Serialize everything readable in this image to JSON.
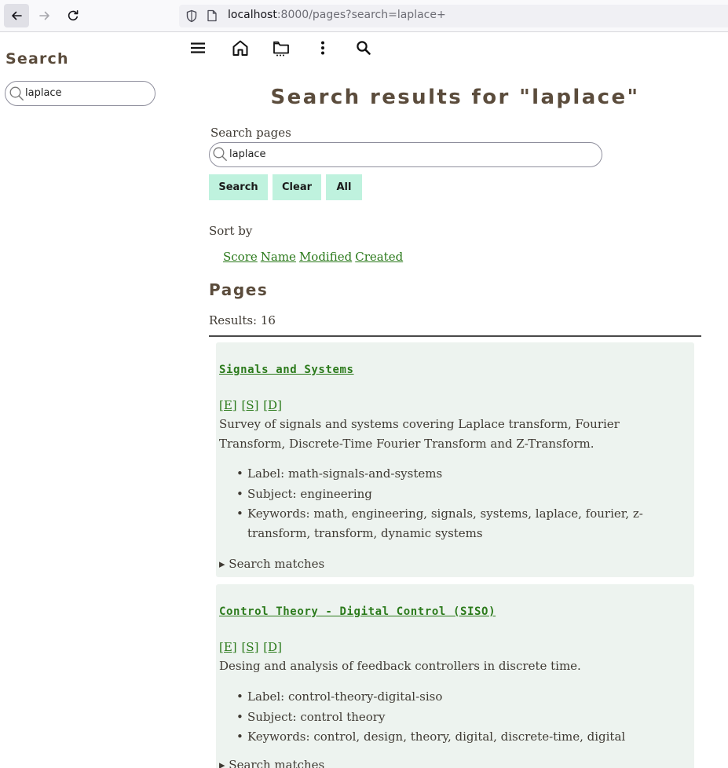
{
  "browser": {
    "url_host": "localhost",
    "url_rest": ":8000/pages?search=laplace+"
  },
  "sidebar": {
    "title": "Search",
    "search_value": "laplace"
  },
  "main": {
    "title": "Search results for \"laplace\"",
    "search_label": "Search pages",
    "search_value": "laplace",
    "buttons": {
      "search": "Search",
      "clear": "Clear",
      "all": "All"
    },
    "sort_label": "Sort by",
    "sort_links": [
      "Score",
      "Name",
      "Modified",
      "Created"
    ],
    "section_title": "Pages",
    "results_count": "Results: 16",
    "results": [
      {
        "title": "Signals and Systems",
        "links": [
          "[E]",
          "[S]",
          "[D]"
        ],
        "description": "Survey of signals and systems covering Laplace transform, Fourier Transform, Discrete-Time Fourier Transform and Z-Transform.",
        "details": [
          "Label: math-signals-and-systems",
          "Subject: engineering",
          "Keywords: math, engineering, signals, systems, laplace, fourier, z-transform, transform, dynamic systems"
        ],
        "matches": "▸ Search matches"
      },
      {
        "title": "Control Theory - Digital Control (SISO)",
        "links": [
          "[E]",
          "[S]",
          "[D]"
        ],
        "description": "Desing and analysis of feedback controllers in discrete time.",
        "details": [
          "Label: control-theory-digital-siso",
          "Subject: control theory",
          "Keywords: control, design, theory, digital, discrete-time, digital"
        ],
        "matches": "▸ Search matches"
      }
    ]
  },
  "icons": {
    "back": "arrow-left-icon",
    "forward": "arrow-right-icon",
    "reload": "reload-icon",
    "shield": "shield-icon",
    "page": "page-icon",
    "menu": "hamburger-menu-icon",
    "home": "home-icon",
    "folder": "folder-icon",
    "more": "more-vertical-icon",
    "search": "search-icon"
  }
}
